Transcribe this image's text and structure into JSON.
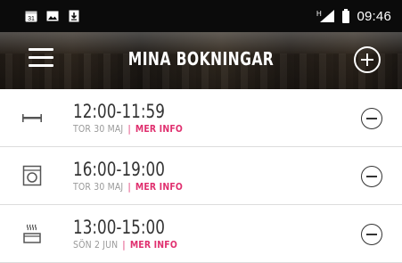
{
  "status_bar": {
    "left_icons": [
      "calendar-icon",
      "image-icon",
      "download-icon"
    ],
    "calendar_day": "31",
    "network": "H",
    "time": "09:46"
  },
  "header": {
    "title": "MINA BOKNINGAR",
    "menu_icon": "hamburger-icon",
    "add_icon": "plus-circle-icon"
  },
  "bookings": [
    {
      "type_icon": "bed-icon",
      "time": "12:00-11:59",
      "date": "TOR 30 MAJ",
      "separator": "|",
      "more": "MER INFO"
    },
    {
      "type_icon": "washing-machine-icon",
      "time": "16:00-19:00",
      "date": "TOR 30 MAJ",
      "separator": "|",
      "more": "MER INFO"
    },
    {
      "type_icon": "sauna-icon",
      "time": "13:00-15:00",
      "date": "SÖN 2 JUN",
      "separator": "|",
      "more": "MER INFO"
    }
  ],
  "colors": {
    "accent": "#e0306f",
    "status_bar": "#0b0b0b",
    "divider": "#dcdcdc"
  }
}
